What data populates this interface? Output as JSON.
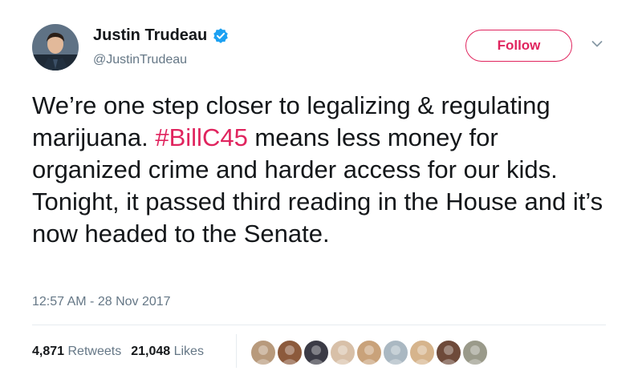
{
  "user": {
    "display_name": "Justin Trudeau",
    "handle": "@JustinTrudeau",
    "avatar_icon": "profile-photo",
    "verified_icon": "verified-badge-icon"
  },
  "follow_button": {
    "label": "Follow"
  },
  "menu_icon": "chevron-down-icon",
  "tweet": {
    "text_before": "We’re one step closer to legalizing & regulating marijuana. ",
    "hashtag": "#BillC45",
    "text_after": " means less money for organized crime and harder access for our kids. Tonight, it passed third reading in the House and it’s now headed to the Senate."
  },
  "timestamp": "12:57 AM - 28 Nov 2017",
  "stats": {
    "retweets_count": "4,871",
    "retweets_label": "Retweets",
    "likes_count": "21,048",
    "likes_label": "Likes"
  },
  "colors": {
    "accent": "#e0245e",
    "text": "#14171a",
    "secondary": "#657786",
    "verified": "#1da1f2"
  },
  "liker_avatars": [
    {
      "name": "liker-avatar-1",
      "color": "#b89a7c"
    },
    {
      "name": "liker-avatar-2",
      "color": "#8c5a3c"
    },
    {
      "name": "liker-avatar-3",
      "color": "#3b3b46"
    },
    {
      "name": "liker-avatar-4",
      "color": "#d8c0a8"
    },
    {
      "name": "liker-avatar-5",
      "color": "#c9a27a"
    },
    {
      "name": "liker-avatar-6",
      "color": "#aab8c2"
    },
    {
      "name": "liker-avatar-7",
      "color": "#d6b48c"
    },
    {
      "name": "liker-avatar-8",
      "color": "#6e4a3a"
    },
    {
      "name": "liker-avatar-9",
      "color": "#9a9a8a"
    }
  ]
}
